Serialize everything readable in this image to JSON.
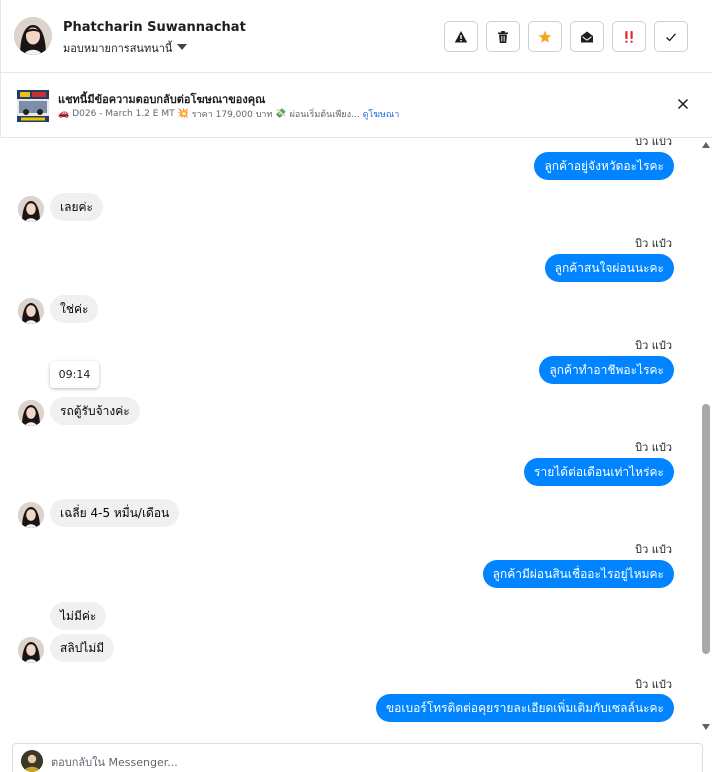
{
  "header": {
    "name": "Phatcharin Suwannachat",
    "assign_label": "มอบหมายการสนทนานี้",
    "actions": [
      "warning-icon",
      "trash-icon",
      "star-icon",
      "envelope-open-icon",
      "exclamation-icon",
      "check-icon"
    ]
  },
  "ad": {
    "title": "แชทนี้มีข้อความตอบกลับต่อโฆษณาของคุณ",
    "car_emoji": "🚗",
    "model": "D026 - March 1.2 E MT",
    "burst_emoji": "💥",
    "price": "ราคา 179,000 บาท",
    "money_emoji": "💸",
    "installment": "ผ่อนเริ่มต้นเพียง...",
    "view_ad": "ดูโฆษณา"
  },
  "chat": {
    "messages": [
      {
        "side": "out",
        "sender": "บิว แป๋ว",
        "text": "ลูกค้าอยู่จังหวัดอะไรคะ"
      },
      {
        "side": "in",
        "text": "เลยค่ะ"
      },
      {
        "side": "out",
        "sender": "บิว แป๋ว",
        "text": "ลูกค้าสนใจผ่อนนะคะ"
      },
      {
        "side": "in",
        "text": "ใช่ค่ะ"
      },
      {
        "side": "out",
        "sender": "บิว แป๋ว",
        "text": "ลูกค้าทำอาชีพอะไรคะ"
      },
      {
        "side": "in",
        "text": "รถตู้รับจ้างค่ะ",
        "time": "09:14"
      },
      {
        "side": "out",
        "sender": "บิว แป๋ว",
        "text": "รายได้ต่อเดือนเท่าไหร่คะ"
      },
      {
        "side": "in",
        "text": "เฉลี่ย 4-5 หมื่น/เดือน"
      },
      {
        "side": "out",
        "sender": "บิว แป๋ว",
        "text": "ลูกค้ามีผ่อนสินเชื่ออะไรอยู่ไหมคะ"
      },
      {
        "side": "in",
        "text": "ไม่มีค่ะ"
      },
      {
        "side": "in",
        "text": "สลิปไม่มี"
      },
      {
        "side": "out",
        "sender": "บิว แป๋ว",
        "text": "ขอเบอร์โทรติดต่อคุยรายละเอียดเพิ่มเติมกับเซลล์นะคะ"
      }
    ]
  },
  "composer": {
    "placeholder": "ตอบกลับใน Messenger..."
  },
  "colors": {
    "outgoing_bubble": "#0084ff",
    "incoming_bubble": "#f0f0f0",
    "star": "#f5a623",
    "urgent": "#e02b2b",
    "link": "#216fdb"
  }
}
